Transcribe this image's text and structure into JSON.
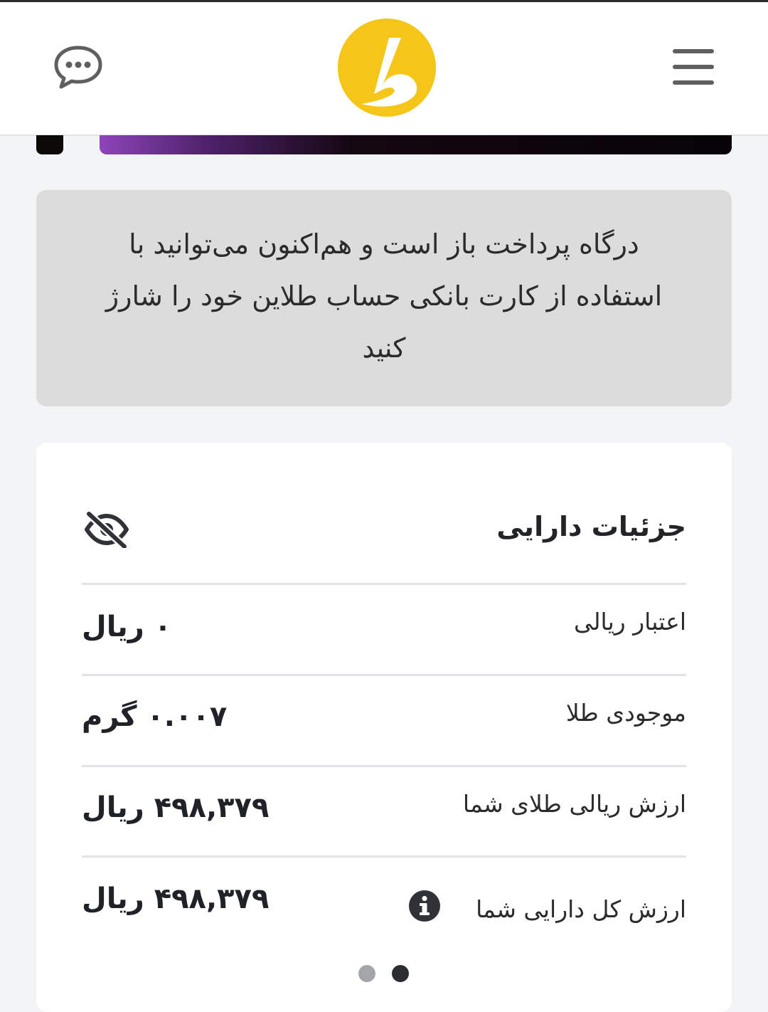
{
  "header": {
    "menu_icon": "hamburger-menu-icon",
    "logo_icon": "talain-logo-icon",
    "chat_icon": "chat-bubble-icon",
    "logo_color": "#f5c518"
  },
  "notice": {
    "text": "درگاه پرداخت باز است و هم‌اکنون می‌توانید با استفاده از کارت بانکی حساب طلاین خود را شارژ کنید"
  },
  "assets": {
    "title": "جزئیات دارایی",
    "visibility_icon": "eye-slash-icon",
    "rows": [
      {
        "label": "اعتبار ریالی",
        "value": "۰ ریال"
      },
      {
        "label": "موجودی طلا",
        "value": "۰.۰۰۷ گرم"
      },
      {
        "label": "ارزش ریالی طلای شما",
        "value": "۴۹۸,۳۷۹ ریال"
      },
      {
        "label": "ارزش کل دارایی شما",
        "value": "۴۹۸,۳۷۹ ریال",
        "icon": "info-icon"
      }
    ]
  },
  "pagination": {
    "total": 2,
    "active_index": 1
  },
  "colors": {
    "page_bg": "#f3f4f6",
    "notice_bg": "#dcdcdc",
    "text_primary": "#1f2328",
    "accent_purple": "#8d45b8"
  }
}
